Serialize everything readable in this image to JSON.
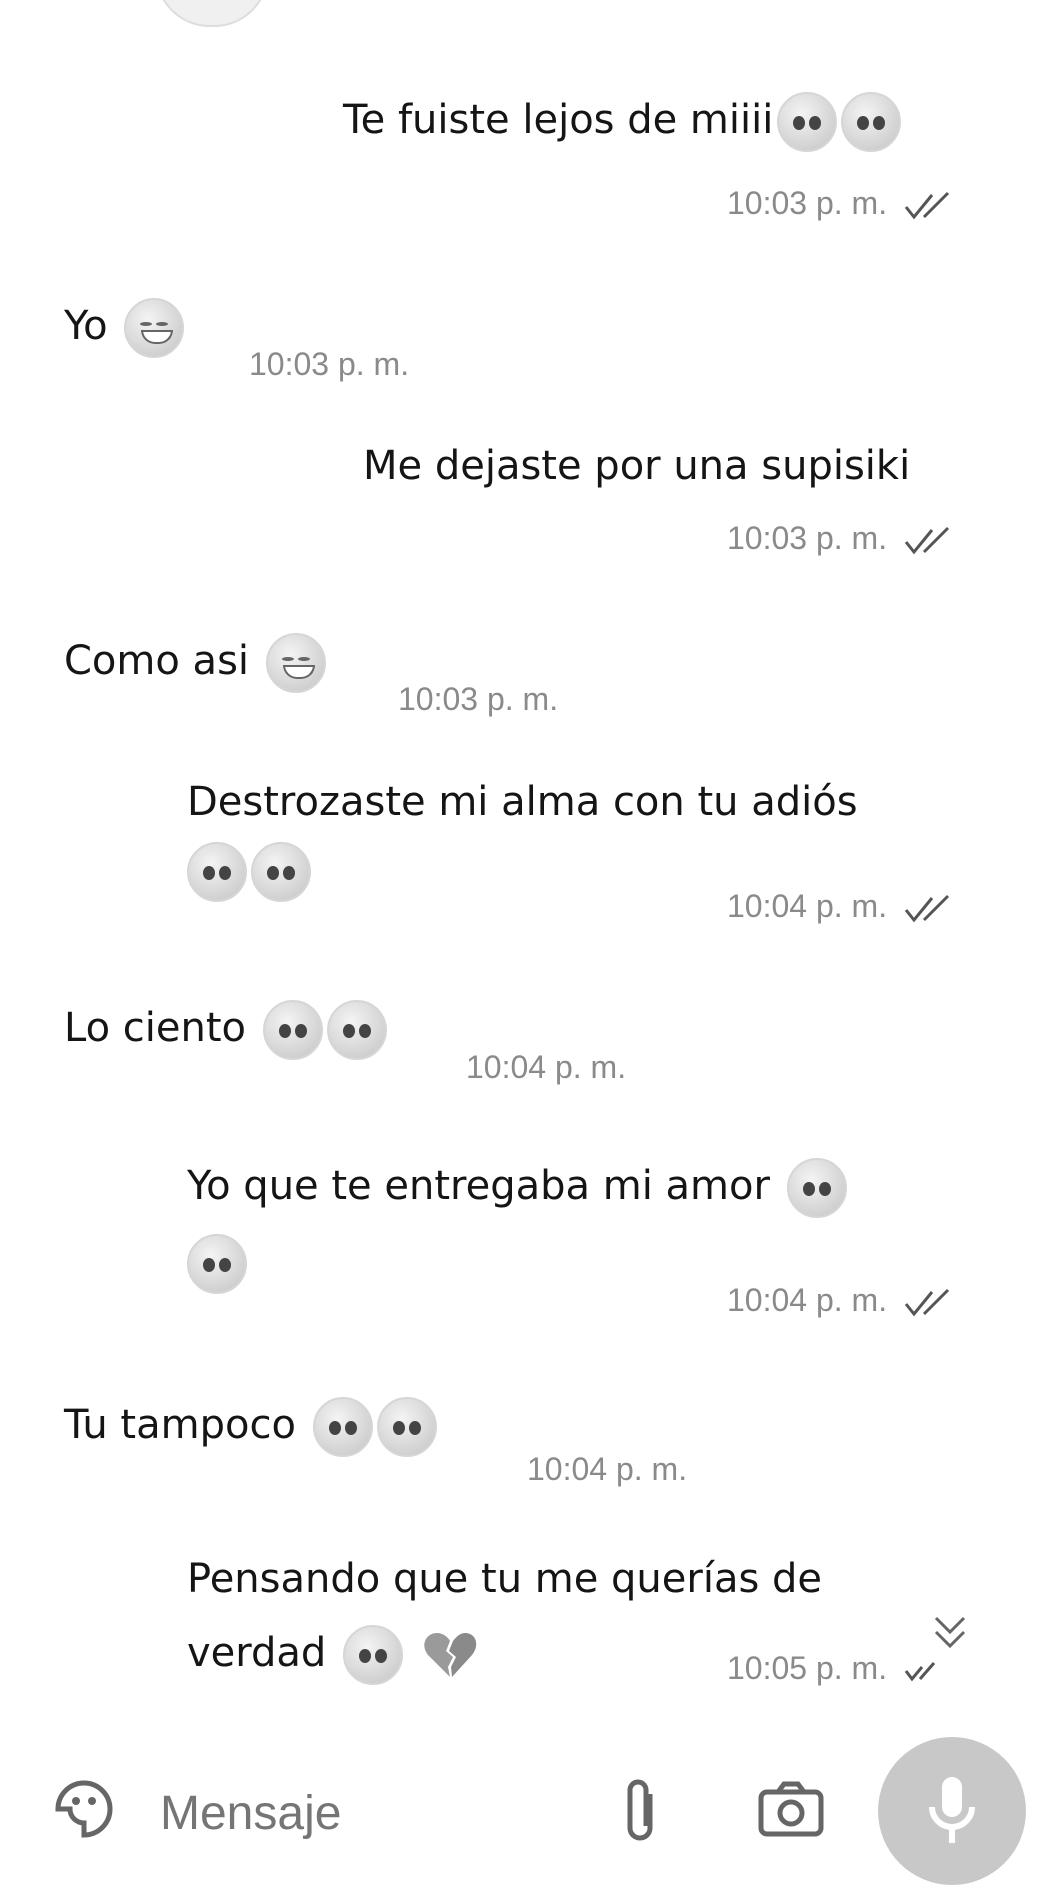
{
  "messages": [
    {
      "side": "out",
      "text": "Te fuiste lejos de miiii",
      "emojis": [
        "tired-face",
        "pleading-face"
      ],
      "time": "10:03 p. m.",
      "status": "read"
    },
    {
      "side": "in",
      "text": "Yo",
      "emojis": [
        "grinning-face"
      ],
      "time": "10:03 p. m."
    },
    {
      "side": "out",
      "text": "Me dejaste por una supisiki",
      "emojis": [],
      "time": "10:03 p. m.",
      "status": "read"
    },
    {
      "side": "in",
      "text": "Como asi",
      "emojis": [
        "grinning-sweat-face"
      ],
      "time": "10:03 p. m."
    },
    {
      "side": "out",
      "text": "Destrozaste mi alma con tu adiós",
      "emojis": [
        "face-rolling-eyes",
        "crying-face"
      ],
      "time": "10:04 p. m.",
      "status": "read"
    },
    {
      "side": "in",
      "text": "Lo ciento",
      "emojis": [
        "pleading-face",
        "sad-tear-face"
      ],
      "time": "10:04 p. m."
    },
    {
      "side": "out",
      "text": "Yo que te entregaba mi amor",
      "emojis": [
        "pleading-face",
        "crying-face"
      ],
      "time": "10:04 p. m.",
      "status": "read"
    },
    {
      "side": "in",
      "text": "Tu tampoco",
      "emojis": [
        "face-rolling-eyes",
        "pleading-face"
      ],
      "time": "10:04 p. m."
    },
    {
      "side": "out",
      "text_line1": "Pensando que tu me querías de",
      "text_line2": "verdad",
      "emojis": [
        "face-rolling-eyes",
        "broken-heart"
      ],
      "time": "10:05 p. m.",
      "status": "delivered"
    }
  ],
  "composer": {
    "placeholder": "Mensaje",
    "sticker_icon": "sticker-icon",
    "attach_icon": "paperclip-icon",
    "camera_icon": "camera-icon",
    "mic_icon": "microphone-icon"
  },
  "colors": {
    "background": "#ffffff",
    "text": "#151515",
    "time": "#8a8a8a",
    "mic_button": "#c8c8c8"
  }
}
